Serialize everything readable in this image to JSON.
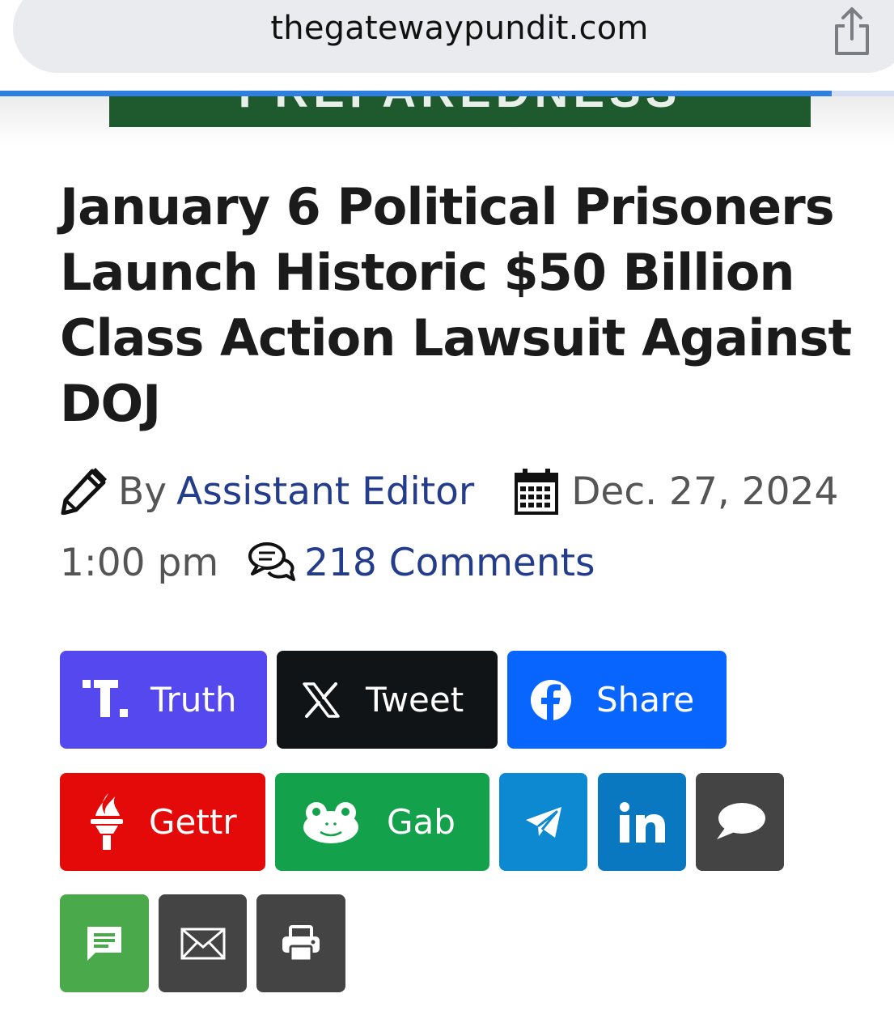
{
  "browser": {
    "url": "thegatewaypundit.com",
    "load_progress": 0.93,
    "share_icon": "share-icon"
  },
  "banner": {
    "text": "PREPAREDNESS"
  },
  "article": {
    "title": "January 6 Political Prisoners Launch Historic $50 Billion Class Action Lawsuit Against DOJ",
    "by_label": "By",
    "author": "Assistant Editor",
    "date": "Dec. 27, 2024",
    "time": "1:00 pm",
    "comments": "218 Comments",
    "icons": {
      "author": "pencil-icon",
      "date": "calendar-icon",
      "comments": "comments-icon"
    }
  },
  "share_buttons": {
    "truth": {
      "label": "Truth",
      "color": "#5448ee",
      "icon": "truth-social-icon"
    },
    "tweet": {
      "label": "Tweet",
      "color": "#101417",
      "icon": "x-icon"
    },
    "share": {
      "label": "Share",
      "color": "#0866ff",
      "icon": "facebook-icon"
    },
    "gettr": {
      "label": "Gettr",
      "color": "#e40a0a",
      "icon": "gettr-torch-icon"
    },
    "gab": {
      "label": "Gab",
      "color": "#13a14c",
      "icon": "gab-frog-icon"
    },
    "telegram": {
      "color": "#0c89d0",
      "icon": "telegram-icon"
    },
    "linkedin": {
      "color": "#0a78c1",
      "icon": "linkedin-icon"
    },
    "comment": {
      "color": "#444444",
      "icon": "speech-bubble-icon"
    },
    "sms": {
      "color": "#4aa94a",
      "icon": "sms-icon"
    },
    "email": {
      "color": "#444444",
      "icon": "email-icon"
    },
    "print": {
      "color": "#444444",
      "icon": "print-icon"
    }
  }
}
